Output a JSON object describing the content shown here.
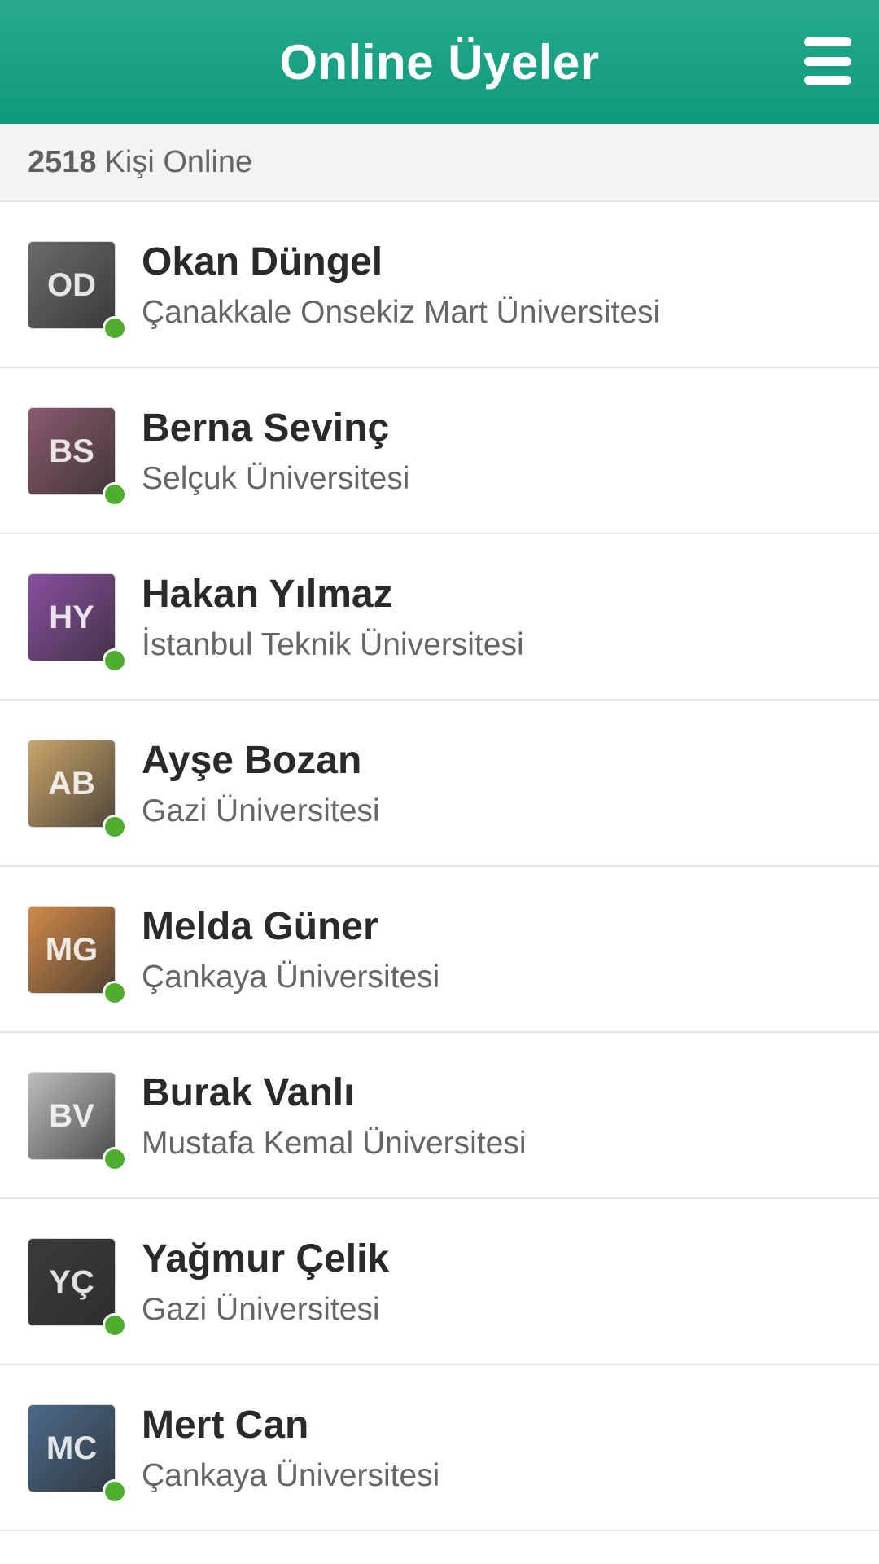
{
  "header": {
    "title": "Online Üyeler",
    "menu_icon": "hamburger-menu-icon"
  },
  "online": {
    "count": "2518",
    "label": "Kişi Online"
  },
  "colors": {
    "header": "#1aa283",
    "online_dot": "#4fae2d",
    "text_dark": "#2a2a2a",
    "text_muted": "#666666"
  },
  "members": [
    {
      "name": "Okan Düngel",
      "university": "Çanakkale Onsekiz Mart Üniversitesi",
      "initials": "OD",
      "avatar_color": "#6b6b6b"
    },
    {
      "name": "Berna Sevinç",
      "university": "Selçuk Üniversitesi",
      "initials": "BS",
      "avatar_color": "#8a5a6e"
    },
    {
      "name": "Hakan Yılmaz",
      "university": "İstanbul Teknik Üniversitesi",
      "initials": "HY",
      "avatar_color": "#8a4fa0"
    },
    {
      "name": "Ayşe Bozan",
      "university": "Gazi Üniversitesi",
      "initials": "AB",
      "avatar_color": "#c9a56a"
    },
    {
      "name": "Melda Güner",
      "university": "Çankaya Üniversitesi",
      "initials": "MG",
      "avatar_color": "#d08a4a"
    },
    {
      "name": "Burak Vanlı",
      "university": "Mustafa Kemal Üniversitesi",
      "initials": "BV",
      "avatar_color": "#bdbdbd"
    },
    {
      "name": "Yağmur Çelik",
      "university": "Gazi Üniversitesi",
      "initials": "YÇ",
      "avatar_color": "#3a3a3a"
    },
    {
      "name": "Mert Can",
      "university": "Çankaya Üniversitesi",
      "initials": "MC",
      "avatar_color": "#4a6a8a"
    }
  ]
}
